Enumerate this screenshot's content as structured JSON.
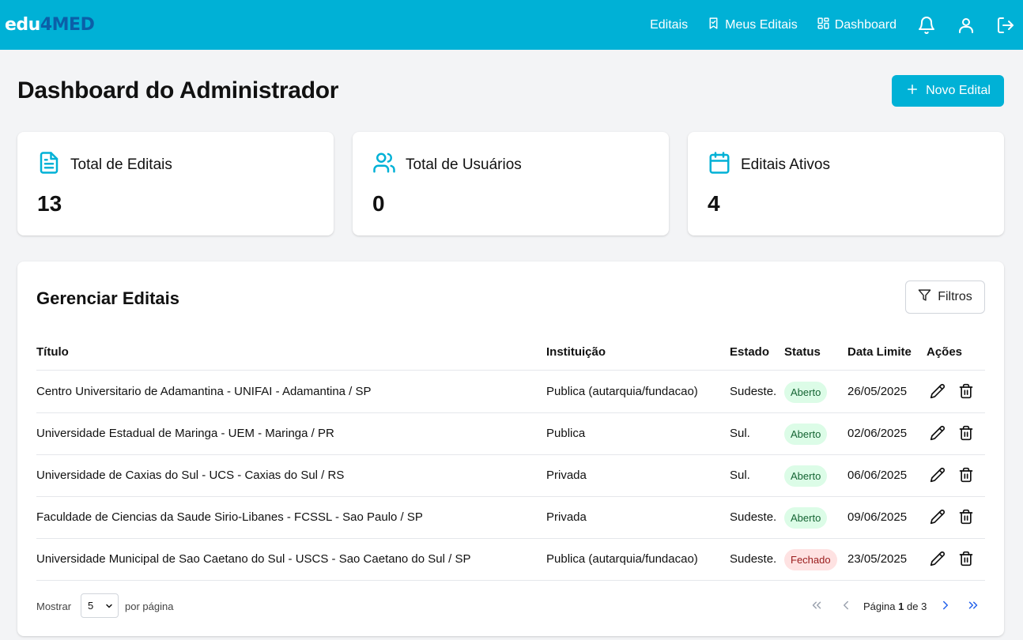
{
  "brand": {
    "part1": "edu",
    "part2": "4MED"
  },
  "nav": {
    "editais": "Editais",
    "meus_editais": "Meus Editais",
    "dashboard": "Dashboard"
  },
  "page": {
    "title": "Dashboard do Administrador",
    "new_button": "Novo Edital"
  },
  "stats": [
    {
      "label": "Total de Editais",
      "value": "13",
      "icon": "document-icon"
    },
    {
      "label": "Total de Usuários",
      "value": "0",
      "icon": "users-icon"
    },
    {
      "label": "Editais Ativos",
      "value": "4",
      "icon": "calendar-icon"
    }
  ],
  "manage": {
    "title": "Gerenciar Editais",
    "filter_button": "Filtros",
    "columns": {
      "titulo": "Título",
      "instituicao": "Instituição",
      "estado": "Estado",
      "status": "Status",
      "data_limite": "Data Limite",
      "acoes": "Ações"
    },
    "rows": [
      {
        "titulo": "Centro Universitario de Adamantina - UNIFAI - Adamantina / SP",
        "instituicao": "Publica (autarquia/fundacao)",
        "estado": "Sudeste.",
        "status": "Aberto",
        "data": "26/05/2025"
      },
      {
        "titulo": "Universidade Estadual de Maringa - UEM - Maringa / PR",
        "instituicao": "Publica",
        "estado": "Sul.",
        "status": "Aberto",
        "data": "02/06/2025"
      },
      {
        "titulo": "Universidade de Caxias do Sul - UCS - Caxias do Sul / RS",
        "instituicao": "Privada",
        "estado": "Sul.",
        "status": "Aberto",
        "data": "06/06/2025"
      },
      {
        "titulo": "Faculdade de Ciencias da Saude Sirio-Libanes - FCSSL - Sao Paulo / SP",
        "instituicao": "Privada",
        "estado": "Sudeste.",
        "status": "Aberto",
        "data": "09/06/2025"
      },
      {
        "titulo": "Universidade Municipal de Sao Caetano do Sul - USCS - Sao Caetano do Sul / SP",
        "instituicao": "Publica (autarquia/fundacao)",
        "estado": "Sudeste.",
        "status": "Fechado",
        "data": "23/05/2025"
      }
    ]
  },
  "pagination": {
    "show_label": "Mostrar",
    "page_size": "5",
    "per_page_label": "por página",
    "page_word": "Página",
    "current": "1",
    "of_word": "de",
    "total": "3"
  },
  "colors": {
    "accent": "#00b1d6",
    "open_bg": "#dcfce7",
    "closed_bg": "#fee2e2"
  }
}
